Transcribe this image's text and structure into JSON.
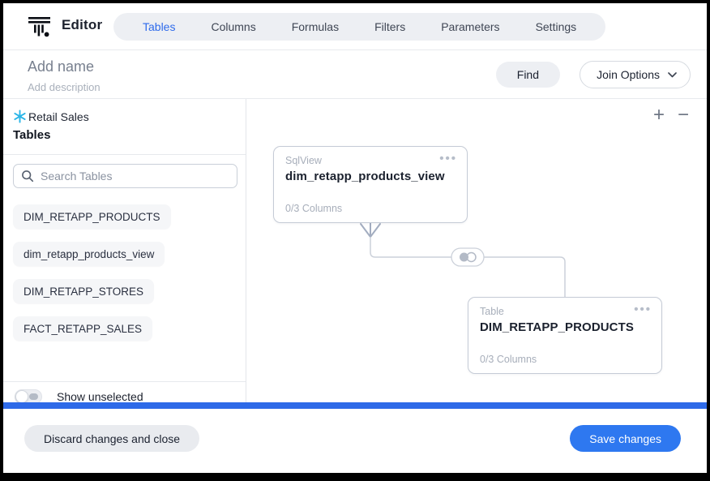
{
  "colors": {
    "accent_bar_blue": "#2E6AE8",
    "save_button_blue": "#2E78F0",
    "active_tab_blue": "#2F6BEB",
    "snowflake_blue": "#29B5E8"
  },
  "header": {
    "app_title": "Editor",
    "tabs": [
      {
        "label": "Tables",
        "active": true
      },
      {
        "label": "Columns",
        "active": false
      },
      {
        "label": "Formulas",
        "active": false
      },
      {
        "label": "Filters",
        "active": false
      },
      {
        "label": "Parameters",
        "active": false
      },
      {
        "label": "Settings",
        "active": false
      }
    ]
  },
  "titlebar": {
    "name_placeholder": "Add name",
    "description_placeholder": "Add description",
    "find_button": "Find",
    "join_options_button": "Join Options"
  },
  "sidebar": {
    "source_name": "Retail Sales",
    "section_title": "Tables",
    "search_placeholder": "Search Tables",
    "tables": [
      "DIM_RETAPP_PRODUCTS",
      "dim_retapp_products_view",
      "DIM_RETAPP_STORES",
      "FACT_RETAPP_SALES"
    ],
    "toggle_label": "Show unselected"
  },
  "canvas": {
    "zoom_in": "+",
    "zoom_out": "−",
    "menu_dots": "•••",
    "nodes": [
      {
        "type": "SqlView",
        "name": "dim_retapp_products_view",
        "columns": "0/3 Columns"
      },
      {
        "type": "Table",
        "name": "DIM_RETAPP_PRODUCTS",
        "columns": "0/3 Columns"
      }
    ]
  },
  "footer": {
    "discard_button": "Discard changes and close",
    "save_button": "Save changes"
  }
}
